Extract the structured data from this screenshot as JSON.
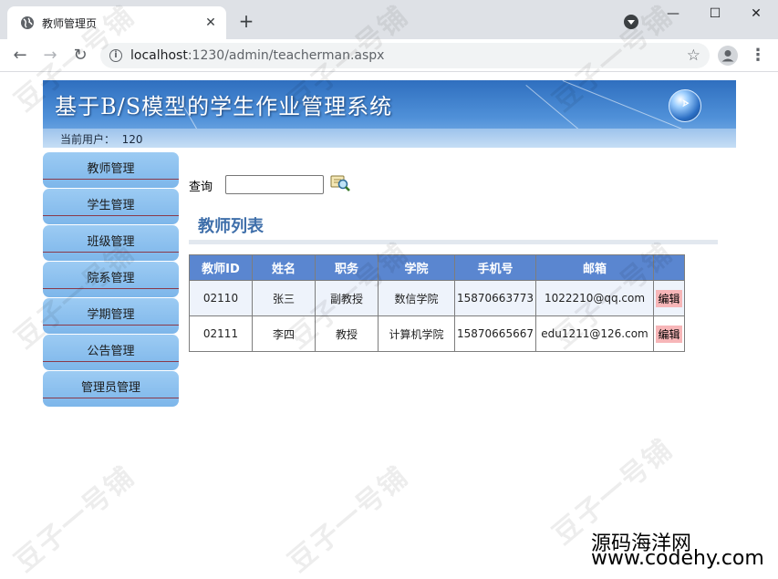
{
  "browser": {
    "tab_title": "教师管理页",
    "tab_close": "✕",
    "new_tab": "+",
    "url_host": "localhost",
    "url_path": ":1230/admin/teacherman.aspx",
    "window_controls": {
      "minimize": "—",
      "maximize": "☐",
      "close": "✕"
    }
  },
  "banner": {
    "title": "基于B/S模型的学生作业管理系统",
    "current_user_label": "当前用户：",
    "current_user": "120"
  },
  "sidebar": {
    "items": [
      {
        "label": "教师管理"
      },
      {
        "label": "学生管理"
      },
      {
        "label": "班级管理"
      },
      {
        "label": "院系管理"
      },
      {
        "label": "学期管理"
      },
      {
        "label": "公告管理"
      },
      {
        "label": "管理员管理"
      }
    ]
  },
  "search": {
    "label": "查询",
    "value": ""
  },
  "list": {
    "title": "教师列表",
    "columns": [
      "教师ID",
      "姓名",
      "职务",
      "学院",
      "手机号",
      "邮箱",
      ""
    ],
    "rows": [
      {
        "id": "02110",
        "name": "张三",
        "title": "副教授",
        "college": "数信学院",
        "phone": "15870663773",
        "email": "1022210@qq.com",
        "action": "编辑"
      },
      {
        "id": "02111",
        "name": "李四",
        "title": "教授",
        "college": "计算机学院",
        "phone": "15870665667",
        "email": "edu1211@126.com",
        "action": "编辑"
      }
    ]
  },
  "watermark": {
    "line1": "源码海洋网",
    "line2": "www.codehy.com",
    "stamp": "豆子一号铺"
  },
  "colors": {
    "banner": "#4f90d8",
    "sidebar": "#7db6ea",
    "table_header": "#5a86d0",
    "list_title": "#3f6faa",
    "edit_highlight": "#f7b6b8"
  }
}
